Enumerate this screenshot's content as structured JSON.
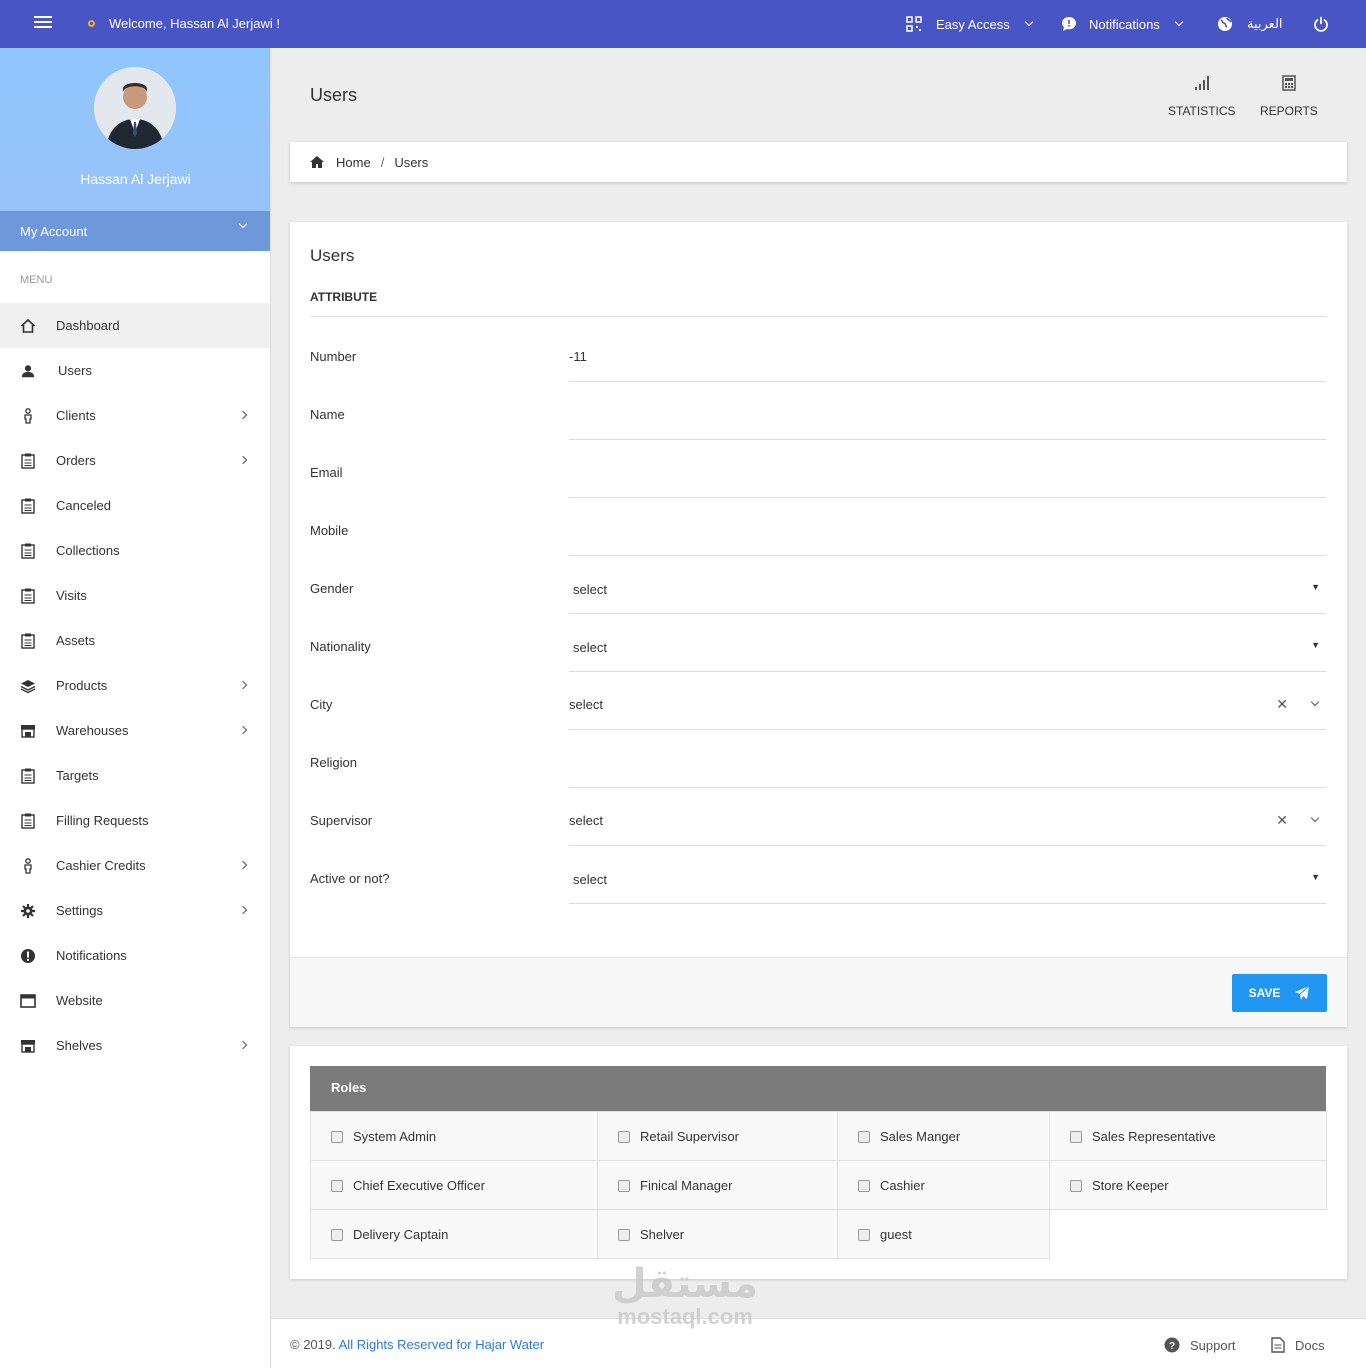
{
  "topbar": {
    "welcome": "Welcome, Hassan Al Jerjawi !",
    "easy_access": "Easy Access",
    "notifications": "Notifications",
    "language": "العربية",
    "colors": {
      "bar": "#4a55c5",
      "dot": "#f0a73a"
    }
  },
  "sidebar": {
    "user_name": "Hassan Al Jerjawi",
    "my_account": "My Account",
    "menu_header": "MENU",
    "items": [
      {
        "label": "Dashboard",
        "icon": "home-icon"
      },
      {
        "label": "Users",
        "icon": "user-icon"
      },
      {
        "label": "Clients",
        "icon": "person-icon"
      },
      {
        "label": "Orders",
        "icon": "clipboard-icon"
      },
      {
        "label": "Canceled",
        "icon": "clipboard-icon"
      },
      {
        "label": "Collections",
        "icon": "clipboard-icon"
      },
      {
        "label": "Visits",
        "icon": "clipboard-icon"
      },
      {
        "label": "Assets",
        "icon": "clipboard-icon"
      },
      {
        "label": "Products",
        "icon": "layers-icon"
      },
      {
        "label": "Warehouses",
        "icon": "store-icon"
      },
      {
        "label": "Targets",
        "icon": "clipboard-icon"
      },
      {
        "label": "Filling Requests",
        "icon": "clipboard-icon"
      },
      {
        "label": "Cashier Credits",
        "icon": "person-icon"
      },
      {
        "label": "Settings",
        "icon": "gear-icon"
      },
      {
        "label": "Notifications",
        "icon": "alert-icon"
      },
      {
        "label": "Website",
        "icon": "browser-icon"
      },
      {
        "label": "Shelves",
        "icon": "store-icon"
      }
    ]
  },
  "header": {
    "title": "Users",
    "statistics": "STATISTICS",
    "reports": "REPORTS"
  },
  "breadcrumb": {
    "home": "Home",
    "sep": "/",
    "current": "Users"
  },
  "form": {
    "title": "Users",
    "section": "ATTRIBUTE",
    "fields": [
      {
        "label": "Number",
        "value": "-11"
      },
      {
        "label": "Name",
        "value": ""
      },
      {
        "label": "Email",
        "value": ""
      },
      {
        "label": "Mobile",
        "value": ""
      },
      {
        "label": "Gender",
        "value": "select"
      },
      {
        "label": "Nationality",
        "value": "select"
      },
      {
        "label": "City",
        "value": "select"
      },
      {
        "label": "Religion",
        "value": ""
      },
      {
        "label": "Supervisor",
        "value": "select"
      },
      {
        "label": "Active or not?",
        "value": "select"
      }
    ],
    "save": "SAVE",
    "save_color": "#2196f3"
  },
  "roles": {
    "title": "Roles",
    "rows": [
      [
        "System Admin",
        "Retail Supervisor",
        "Sales Manger",
        "Sales Representative"
      ],
      [
        "Chief Executive Officer",
        "Finical Manager",
        "Cashier",
        "Store Keeper"
      ],
      [
        "Delivery Captain",
        "Shelver",
        "guest"
      ]
    ]
  },
  "footer": {
    "copyright": "© 2019.",
    "rights": "All Rights Reserved for Hajar Water",
    "support": "Support",
    "docs": "Docs"
  },
  "watermark": {
    "arabic": "مستقل",
    "latin": "mostaql.com"
  }
}
